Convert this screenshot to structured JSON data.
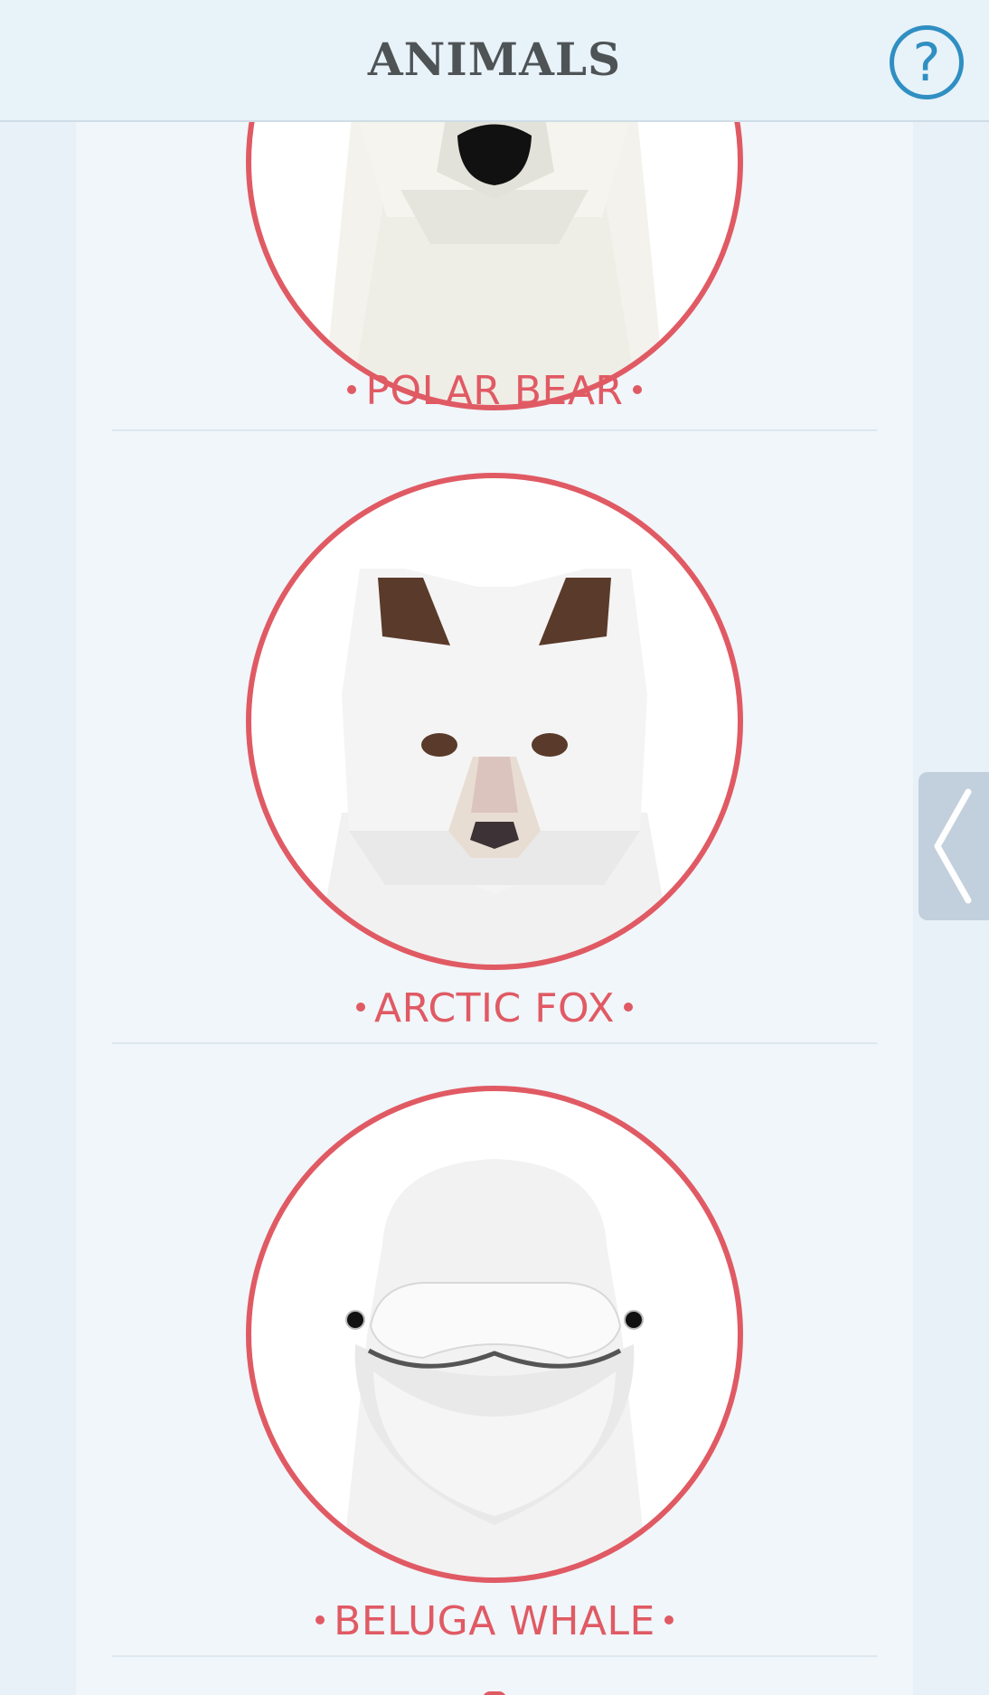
{
  "header": {
    "title": "ANIMALS",
    "help_label": "?"
  },
  "animals": [
    {
      "name": "POLAR BEAR",
      "icon": "polar-bear-icon"
    },
    {
      "name": "ARCTIC FOX",
      "icon": "arctic-fox-icon"
    },
    {
      "name": "BELUGA WHALE",
      "icon": "beluga-whale-icon"
    }
  ],
  "side_tab": {
    "icon": "chevron-left-icon"
  },
  "colors": {
    "accent_red": "#e05a64",
    "help_blue": "#2f8fc2",
    "background": "#e8f1f8"
  }
}
